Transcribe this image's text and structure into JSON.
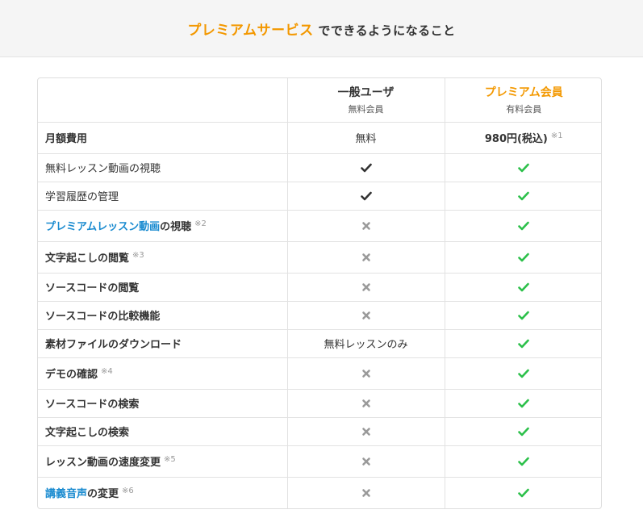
{
  "banner": {
    "title_accent": "プレミアムサービス",
    "title_rest": " でできるようになること",
    "accent_color": "#f39800"
  },
  "table": {
    "columns": [
      {
        "name": "一般ユーザ",
        "type": "無料会員"
      },
      {
        "name": "プレミアム会員",
        "type": "有料会員"
      }
    ],
    "rows": [
      {
        "feature": "月額費用",
        "bold": true,
        "free": "無料",
        "premium": "980円(税込)",
        "note": "※1"
      },
      {
        "feature": "無料レッスン動画の視聴",
        "bold": false,
        "free_icon": "check-icon",
        "premium_icon": "check-icon"
      },
      {
        "feature": "学習履歴の管理",
        "bold": false,
        "free_icon": "check-icon",
        "premium_icon": "check-icon"
      },
      {
        "feature_link": "プレミアムレッスン動画",
        "feature": "の視聴",
        "note": "※2",
        "free_icon": "cross-icon",
        "premium_icon": "check-icon"
      },
      {
        "feature": "文字起こしの閲覧",
        "note": "※3",
        "bold": true,
        "free_icon": "cross-icon",
        "premium_icon": "check-icon"
      },
      {
        "feature": "ソースコードの閲覧",
        "bold": true,
        "free_icon": "cross-icon",
        "premium_icon": "check-icon"
      },
      {
        "feature": "ソースコードの比較機能",
        "bold": true,
        "free_icon": "cross-icon",
        "premium_icon": "check-icon"
      },
      {
        "feature": "素材ファイルのダウンロード",
        "bold": true,
        "free": "無料レッスンのみ",
        "premium_icon": "check-icon"
      },
      {
        "feature": "デモの確認",
        "note": "※4",
        "bold": true,
        "free_icon": "cross-icon",
        "premium_icon": "check-icon"
      },
      {
        "feature": "ソースコードの検索",
        "bold": true,
        "free_icon": "cross-icon",
        "premium_icon": "check-icon"
      },
      {
        "feature": "文字起こしの検索",
        "bold": true,
        "free_icon": "cross-icon",
        "premium_icon": "check-icon"
      },
      {
        "feature": "レッスン動画の速度変更",
        "note": "※5",
        "bold": true,
        "free_icon": "cross-icon",
        "premium_icon": "check-icon"
      },
      {
        "feature_link": "講義音声",
        "feature": "の変更",
        "note": "※6",
        "free_icon": "cross-icon",
        "premium_icon": "check-icon"
      }
    ]
  },
  "colors": {
    "check_free": "#333333",
    "check_premium": "#2cc04a",
    "cross": "#9a9a9a",
    "link": "#1a8bd0"
  }
}
